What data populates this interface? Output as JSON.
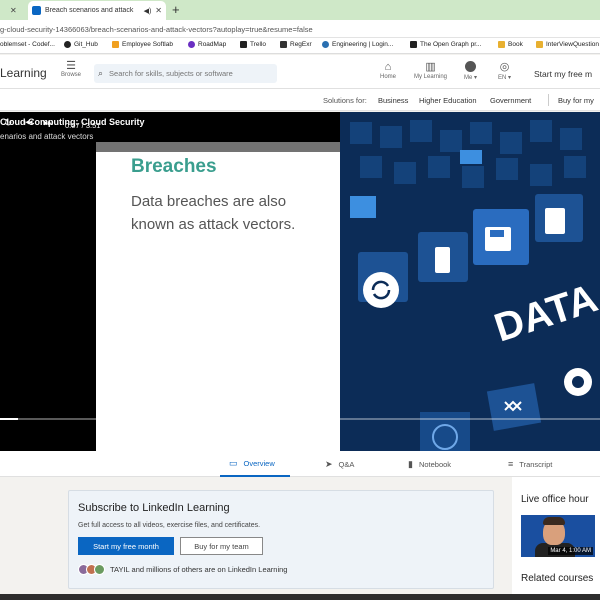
{
  "browser": {
    "active_tab_title": "Breach scenarios and attack",
    "url": "g-cloud-security-14366063/breach-scenarios-and-attack-vectors?autoplay=true&resume=false",
    "new_tab": "+",
    "close": "✕",
    "bookmarks": [
      "oblemset - Codef...",
      "Git_Hub",
      "Employee Softlab",
      "RoadMap",
      "Trello",
      "RegExr",
      "Engineering | Login...",
      "The Open Graph pr...",
      "Book",
      "InterViewQuestion"
    ]
  },
  "header": {
    "logo": "Learning",
    "browse_label": "Browse",
    "search_placeholder": "Search for skills, subjects or software",
    "nav": {
      "home": "Home",
      "my_learning": "My Learning",
      "me": "Me",
      "lang": "EN"
    },
    "trial": "Start my free m"
  },
  "subnav": {
    "solutions_for": "Solutions for:",
    "business": "Business",
    "higher_ed": "Higher Education",
    "government": "Government",
    "buy": "Buy for my"
  },
  "video": {
    "course_title": "Cloud Computing: Cloud Security",
    "chapter_title": "enarios and attack vectors",
    "slide_title": "Breaches",
    "slide_body": "Data breaches are also known as attack vectors.",
    "image_text": "DATA BR",
    "time": "0:07 / 3:51",
    "progress": 0.03
  },
  "content_tabs": [
    "Overview",
    "Q&A",
    "Notebook",
    "Transcript"
  ],
  "subscribe": {
    "title": "Subscribe to LinkedIn Learning",
    "desc": "Get full access to all videos, exercise files, and certificates.",
    "primary": "Start my free month",
    "secondary": "Buy for my team",
    "members": "TAYIL and millions of others are on LinkedIn Learning"
  },
  "right": {
    "live_heading": "Live office hour",
    "thumb_date": "Mar 4, 1:00 AM",
    "related_heading": "Related courses"
  },
  "colors": {
    "accent": "#0a66c2",
    "slide_title": "#3a9e8e",
    "tabstrip": "#cfe8c8"
  }
}
